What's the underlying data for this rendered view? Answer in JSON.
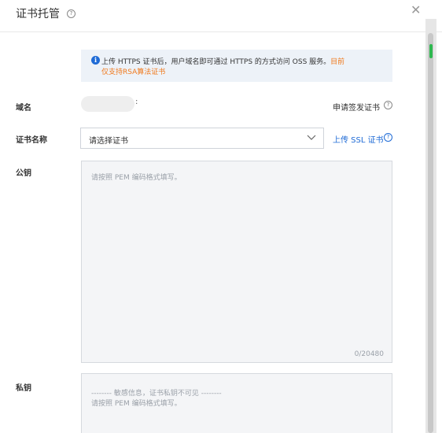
{
  "dialog": {
    "title": "证书托管",
    "help_icon": "question-circle-icon",
    "close_icon": "close-icon"
  },
  "notice": {
    "icon": "info-circle-icon",
    "text_main": "上传 HTTPS 证书后，用户域名即可通过 HTTPS 的方式访问 OSS 服务。",
    "text_highlight_1": "目前",
    "text_highlight_2": "仅支持RSA算法证书",
    "highlight_color": "#f07a1e"
  },
  "domain": {
    "label": "域名",
    "separator": ":",
    "apply_link": "申请签发证书"
  },
  "certificate": {
    "label": "证书名称",
    "selected": "请选择证书",
    "upload_link": "上传 SSL 证书",
    "link_color": "#1f6bd6"
  },
  "public_key": {
    "label": "公钥",
    "placeholder": "请按照 PEM 编码格式填写。",
    "counter": "0/20480"
  },
  "private_key": {
    "label": "私钥",
    "hidden_notice": "-------- 敏感信息，证书私钥不可见 --------",
    "placeholder": "请按照 PEM 编码格式填写。"
  }
}
